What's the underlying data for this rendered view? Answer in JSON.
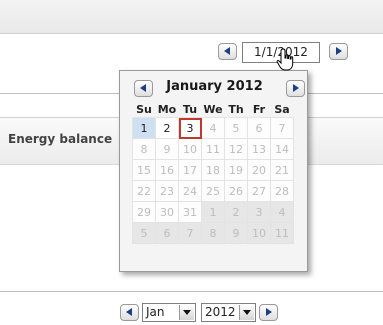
{
  "date_picker": {
    "value": "1/1/2012"
  },
  "calendar": {
    "title": "January 2012",
    "weekdays": [
      "Su",
      "Mo",
      "Tu",
      "We",
      "Th",
      "Fr",
      "Sa"
    ],
    "weeks": [
      [
        {
          "day": "1",
          "state": "selected"
        },
        {
          "day": "2",
          "state": "current"
        },
        {
          "day": "3",
          "state": "today"
        },
        {
          "day": "4",
          "state": "muted"
        },
        {
          "day": "5",
          "state": "muted"
        },
        {
          "day": "6",
          "state": "muted"
        },
        {
          "day": "7",
          "state": "muted"
        }
      ],
      [
        {
          "day": "8",
          "state": "muted"
        },
        {
          "day": "9",
          "state": "muted"
        },
        {
          "day": "10",
          "state": "muted"
        },
        {
          "day": "11",
          "state": "muted"
        },
        {
          "day": "12",
          "state": "muted"
        },
        {
          "day": "13",
          "state": "muted"
        },
        {
          "day": "14",
          "state": "muted"
        }
      ],
      [
        {
          "day": "15",
          "state": "muted"
        },
        {
          "day": "16",
          "state": "muted"
        },
        {
          "day": "17",
          "state": "muted"
        },
        {
          "day": "18",
          "state": "muted"
        },
        {
          "day": "19",
          "state": "muted"
        },
        {
          "day": "20",
          "state": "muted"
        },
        {
          "day": "21",
          "state": "muted"
        }
      ],
      [
        {
          "day": "22",
          "state": "muted"
        },
        {
          "day": "23",
          "state": "muted"
        },
        {
          "day": "24",
          "state": "muted"
        },
        {
          "day": "25",
          "state": "muted"
        },
        {
          "day": "26",
          "state": "muted"
        },
        {
          "day": "27",
          "state": "muted"
        },
        {
          "day": "28",
          "state": "muted"
        }
      ],
      [
        {
          "day": "29",
          "state": "muted"
        },
        {
          "day": "30",
          "state": "muted"
        },
        {
          "day": "31",
          "state": "muted"
        },
        {
          "day": "1",
          "state": "other-month"
        },
        {
          "day": "2",
          "state": "other-month"
        },
        {
          "day": "3",
          "state": "other-month"
        },
        {
          "day": "4",
          "state": "other-month"
        }
      ],
      [
        {
          "day": "5",
          "state": "other-month"
        },
        {
          "day": "6",
          "state": "other-month"
        },
        {
          "day": "7",
          "state": "other-month"
        },
        {
          "day": "8",
          "state": "other-month"
        },
        {
          "day": "9",
          "state": "other-month"
        },
        {
          "day": "10",
          "state": "other-month"
        },
        {
          "day": "11",
          "state": "other-month"
        }
      ]
    ]
  },
  "section": {
    "label": "Energy balance"
  },
  "bottom_nav": {
    "month": "Jan",
    "year": "2012"
  },
  "icons": {
    "prev": "chevron-left-icon",
    "next": "chevron-right-icon",
    "cursor": "hand-pointer-icon",
    "dropdown": "chevron-down-icon"
  },
  "colors": {
    "arrow": "#1a3f87",
    "today_border": "#c0392b",
    "selected_bg": "#cfe0f3"
  }
}
